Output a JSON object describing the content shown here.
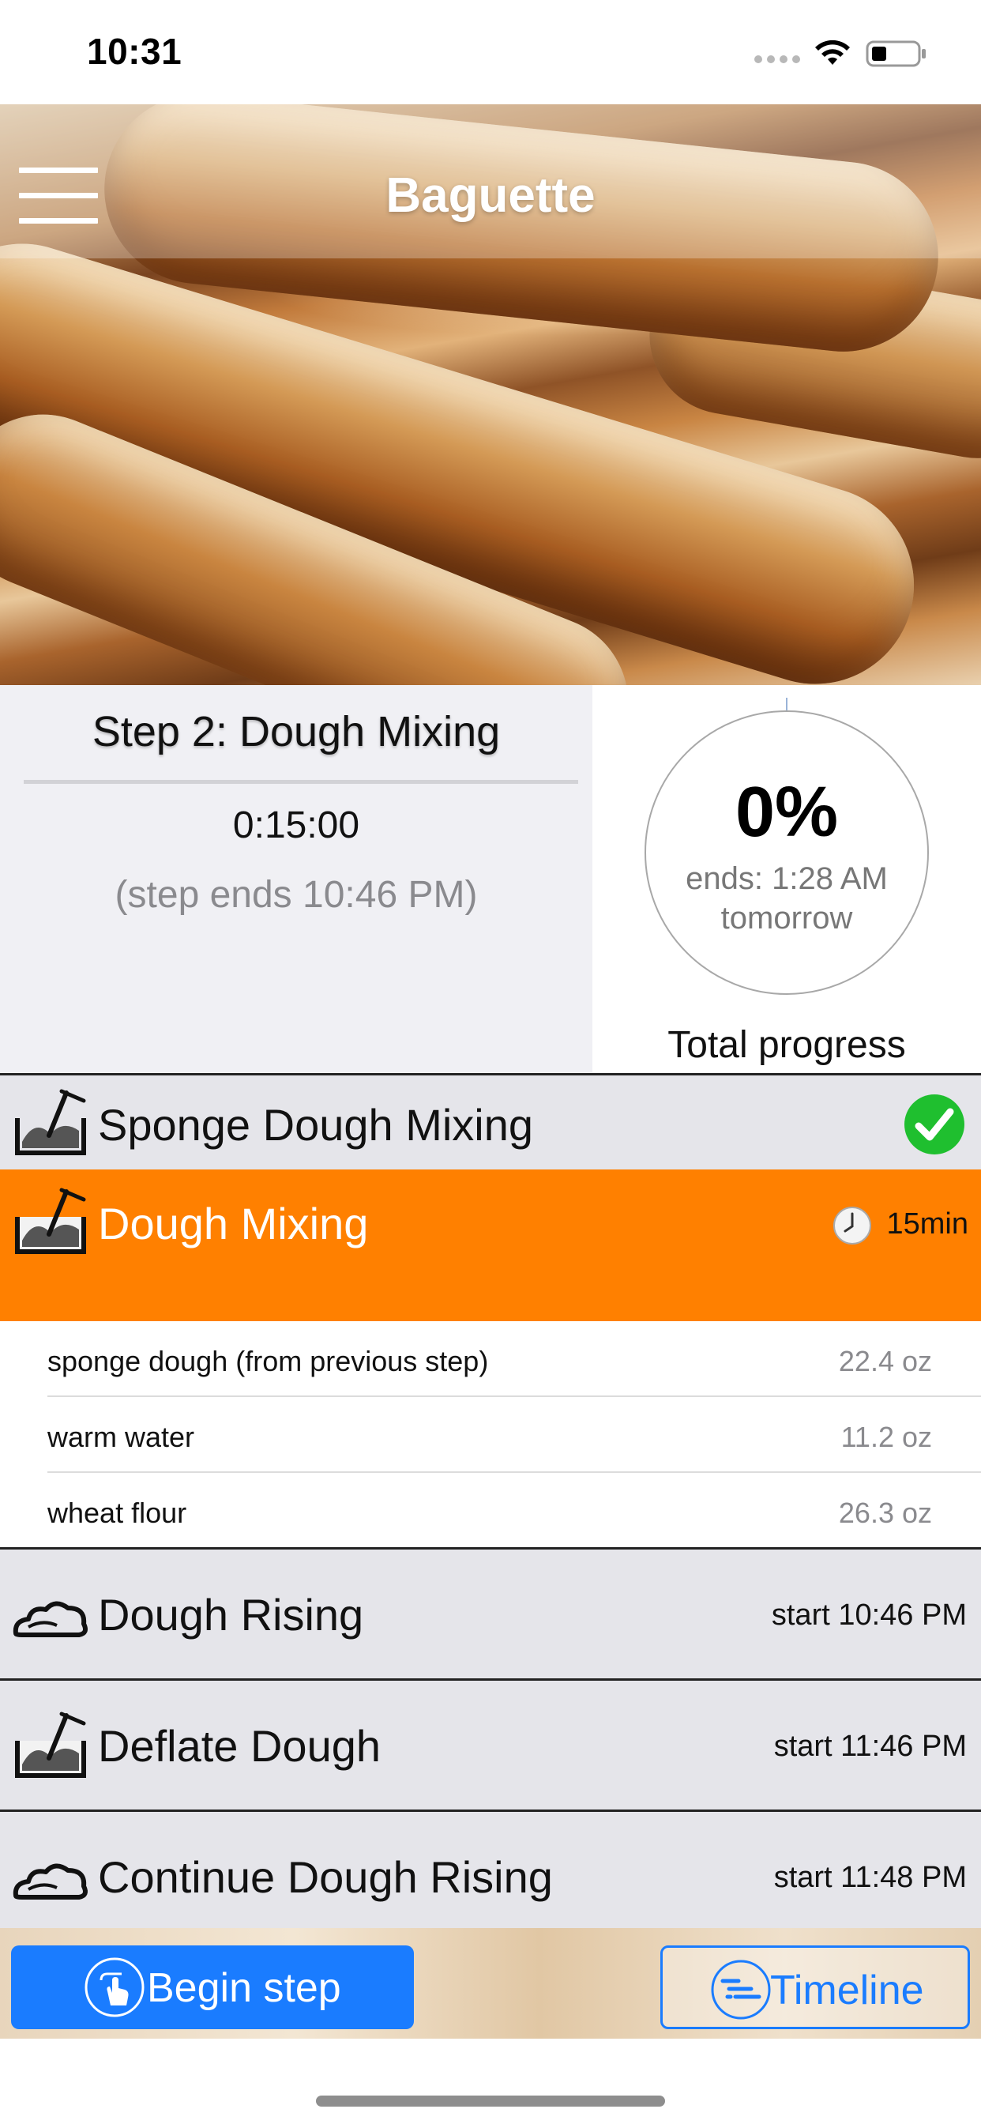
{
  "status_bar": {
    "time": "10:31"
  },
  "nav": {
    "title": "Baguette"
  },
  "current_step": {
    "title": "Step 2: Dough Mixing",
    "timer": "0:15:00",
    "ends_text": "(step ends 10:46 PM)"
  },
  "total_progress": {
    "percent_text": "0%",
    "percent_value": 0,
    "ends_line1": "ends: 1:28 AM",
    "ends_line2": "tomorrow",
    "label": "Total progress"
  },
  "steps": [
    {
      "label": "Sponge Dough Mixing",
      "icon": "mixing-bowl-icon",
      "status": "completed"
    },
    {
      "label": "Dough Mixing",
      "icon": "mixing-bowl-icon",
      "status": "active",
      "duration": "15min"
    },
    {
      "label": "Dough Rising",
      "icon": "rising-dough-icon",
      "status": "upcoming",
      "meta": "start 10:46 PM"
    },
    {
      "label": "Deflate Dough",
      "icon": "mixing-bowl-icon",
      "status": "upcoming",
      "meta": "start 11:46 PM"
    },
    {
      "label": "Continue Dough Rising",
      "icon": "rising-dough-icon",
      "status": "upcoming",
      "meta": "start 11:48 PM"
    }
  ],
  "ingredients": [
    {
      "name": "sponge dough (from previous step)",
      "qty": "22.4 oz"
    },
    {
      "name": "warm water",
      "qty": "11.2 oz"
    },
    {
      "name": "wheat flour",
      "qty": "26.3 oz"
    }
  ],
  "actions": {
    "begin_label": "Begin step",
    "timeline_label": "Timeline"
  },
  "colors": {
    "accent_blue": "#1a7cff",
    "active_orange": "#ff8000",
    "check_green": "#1fbf2f",
    "row_gray": "#e5e5ea"
  }
}
